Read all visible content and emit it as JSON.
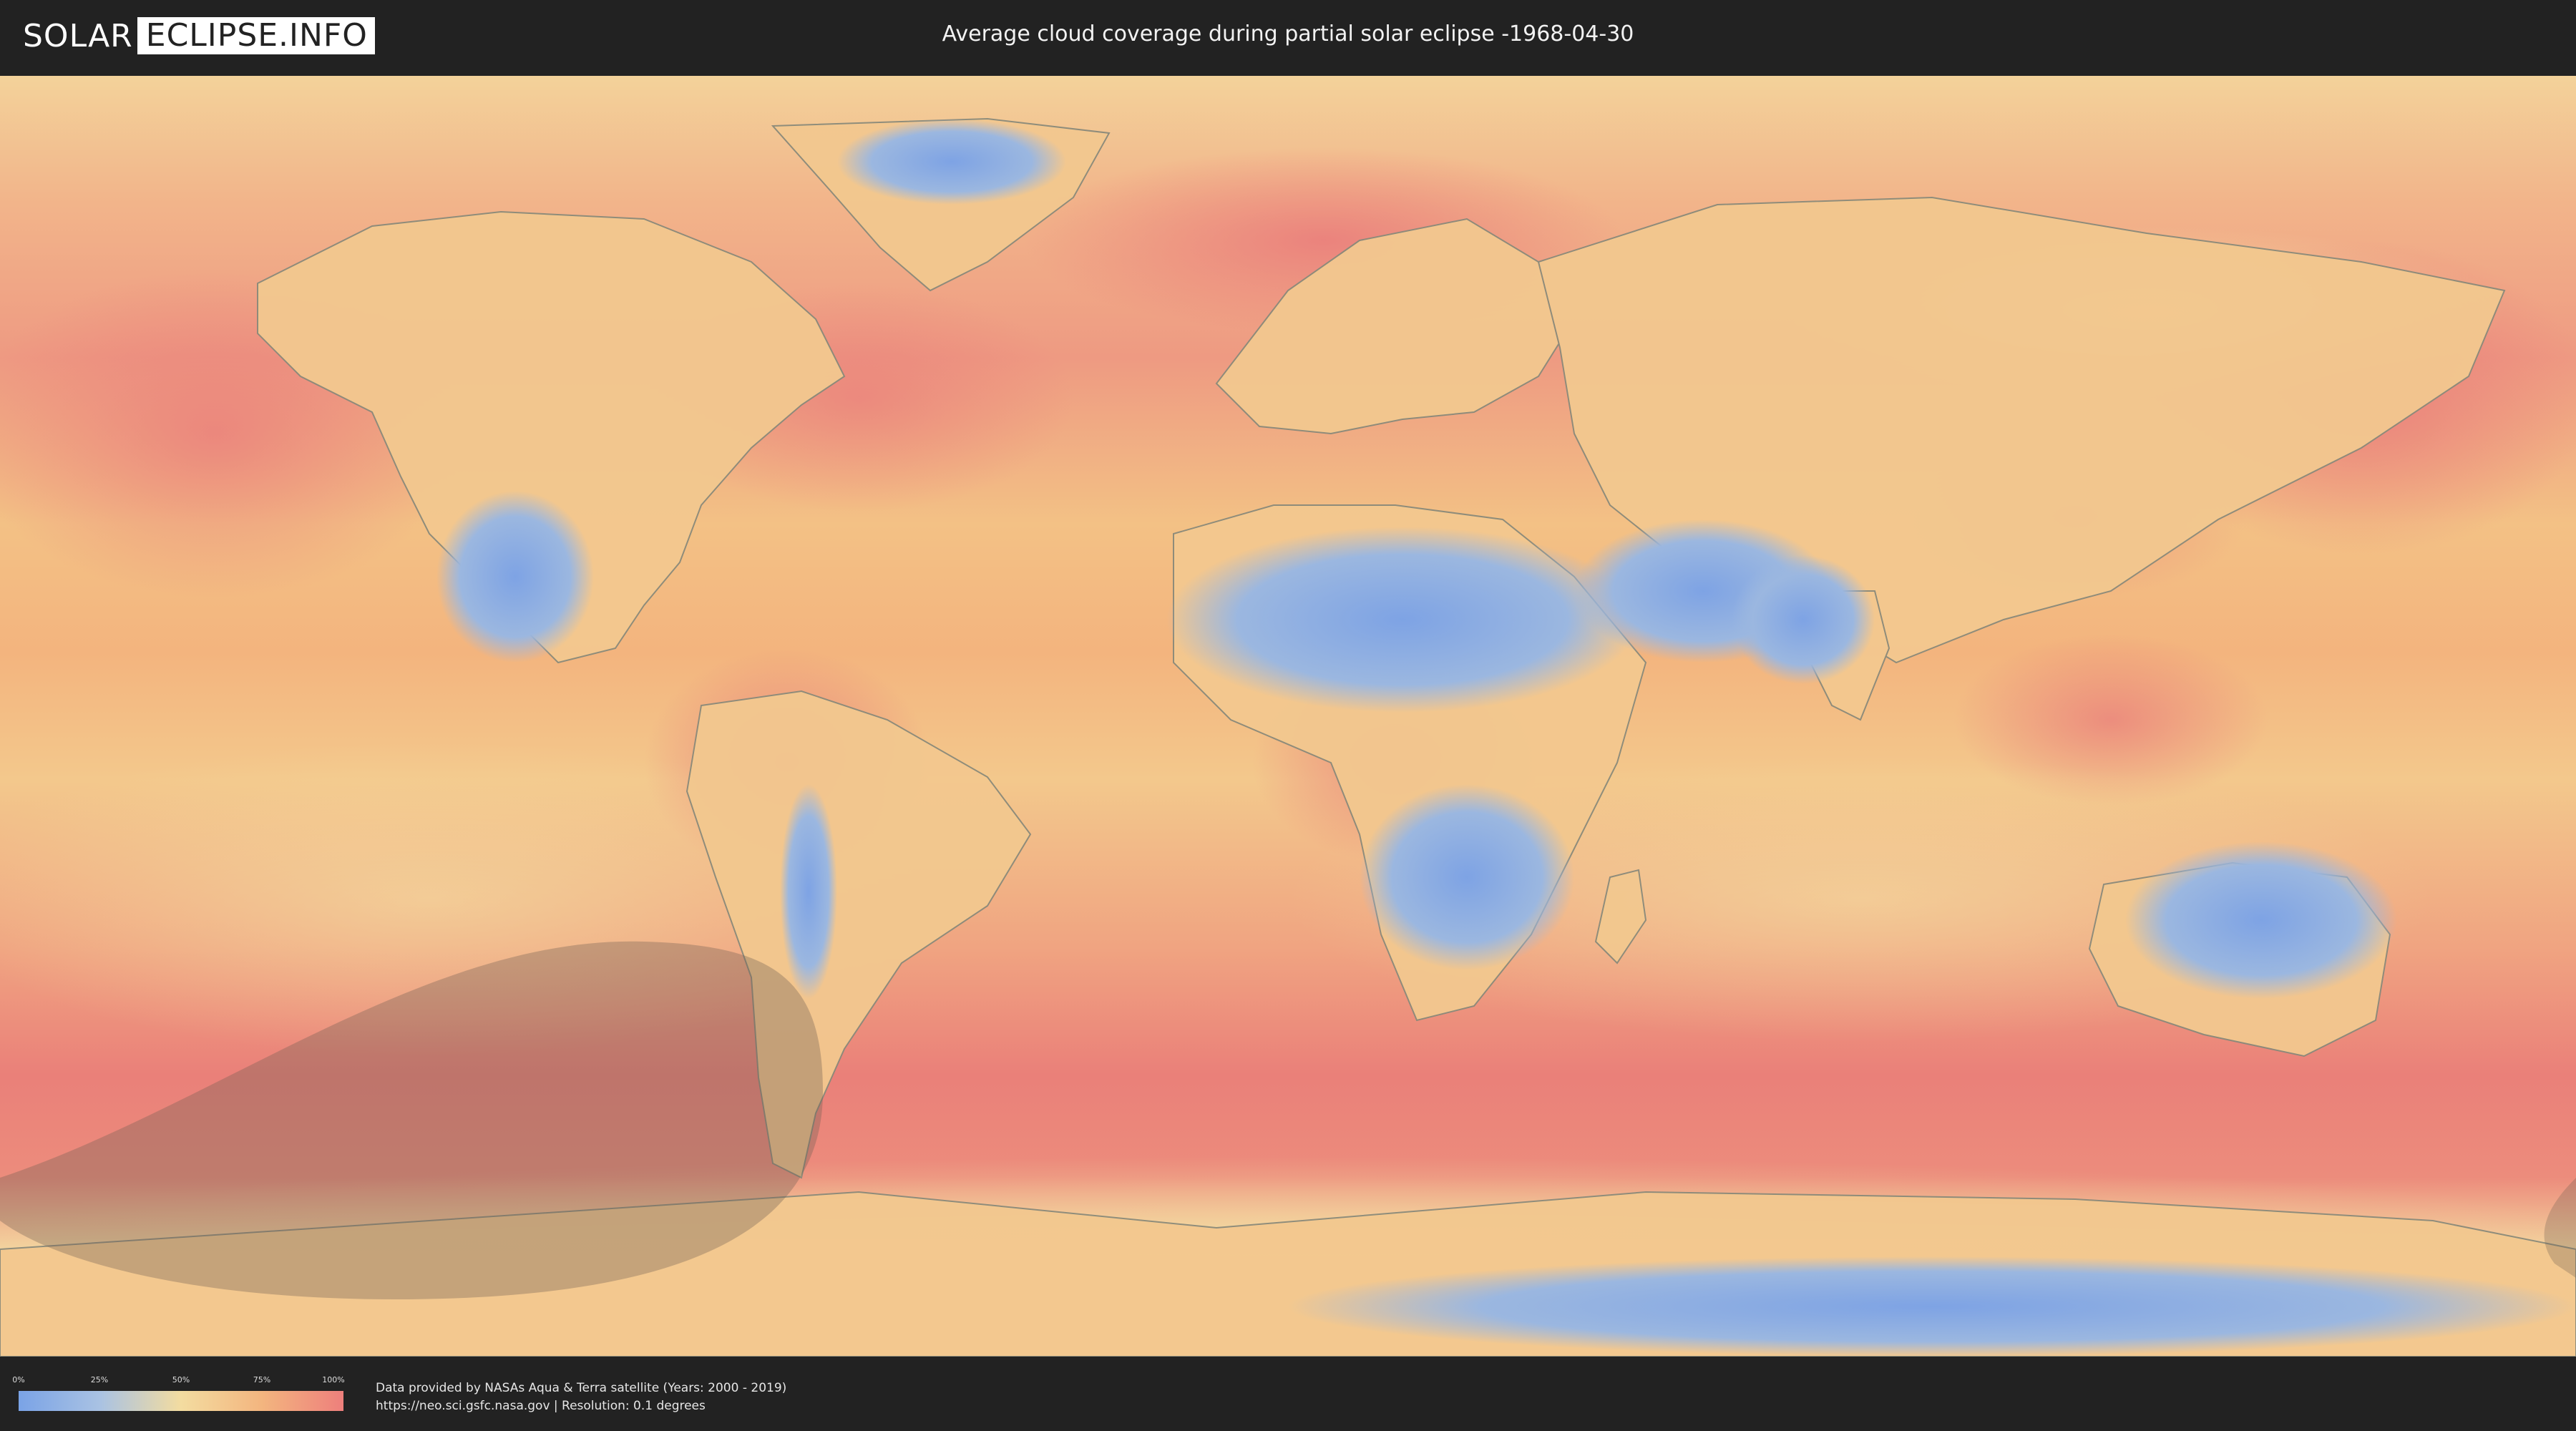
{
  "header": {
    "logo_left": "SOLAR",
    "logo_right": "ECLIPSE.INFO",
    "title": "Average cloud coverage during partial solar eclipse -1968-04-30"
  },
  "legend": {
    "ticks": [
      "0%",
      "25%",
      "50%",
      "75%",
      "100%"
    ],
    "colors": [
      "#7aa3e6",
      "#a9c2e3",
      "#f3dca0",
      "#f3b57f",
      "#ee7f7c"
    ]
  },
  "credits": {
    "line1": "Data provided by NASAs Aqua & Terra satellite (Years: 2000 - 2019)",
    "line2": "https://neo.sci.gsfc.nasa.gov | Resolution: 0.1 degrees"
  },
  "map": {
    "ocean_color": "#f1b27f",
    "cloudy_color": "#ea8079",
    "clear_color": "#86a9e2",
    "eclipse_shadow_color": "#7a6a5a"
  }
}
